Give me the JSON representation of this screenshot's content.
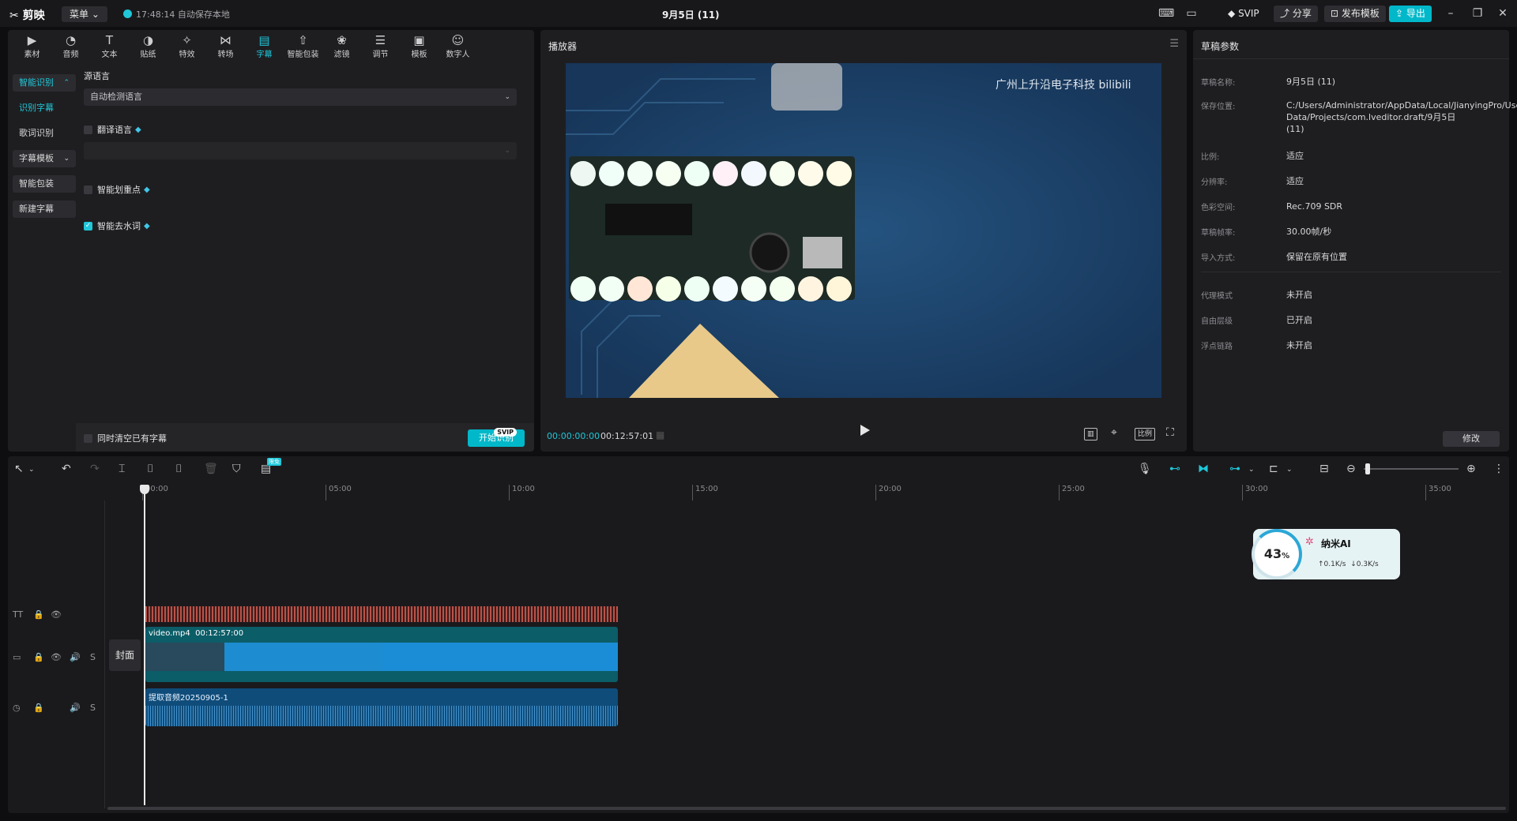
{
  "titlebar": {
    "logo": "剪映",
    "menu_label": "菜单",
    "save_status": "17:48:14 自动保存本地",
    "title": "9月5日 (11)",
    "svip_label": "SVIP",
    "share_label": "分享",
    "publish_label": "发布模板",
    "export_label": "导出"
  },
  "toolbar": {
    "items": [
      {
        "label": "素材",
        "icon": "media-icon"
      },
      {
        "label": "音频",
        "icon": "audio-icon"
      },
      {
        "label": "文本",
        "icon": "text-icon"
      },
      {
        "label": "贴纸",
        "icon": "sticker-icon"
      },
      {
        "label": "特效",
        "icon": "effects-icon"
      },
      {
        "label": "转场",
        "icon": "transition-icon"
      },
      {
        "label": "字幕",
        "icon": "caption-icon"
      },
      {
        "label": "智能包装",
        "icon": "package-icon"
      },
      {
        "label": "滤镜",
        "icon": "filter-icon"
      },
      {
        "label": "调节",
        "icon": "adjust-icon"
      },
      {
        "label": "模板",
        "icon": "template-icon"
      },
      {
        "label": "数字人",
        "icon": "avatar-icon"
      }
    ]
  },
  "sidenav": {
    "smart_recognize": "智能识别",
    "recognize_caption": "识别字幕",
    "recognize_lyrics": "歌词识别",
    "caption_template": "字幕模板",
    "smart_package": "智能包装",
    "new_caption": "新建字幕"
  },
  "caption_settings": {
    "source_language_label": "源语言",
    "source_language_value": "自动检测语言",
    "translate_label": "翻译语言",
    "smart_key_label": "智能划重点",
    "smart_filler_label": "智能去水词",
    "clear_existing_label": "同时清空已有字幕",
    "start_button": "开始识别",
    "start_badge": "SVIP"
  },
  "player": {
    "title": "播放器",
    "current_time": "00:00:00:00",
    "total_time": "00:12:57:01",
    "ratio_label": "比例",
    "watermark": "广州上升沿电子科技 bilibili"
  },
  "props": {
    "title": "草稿参数",
    "rows": [
      {
        "k": "草稿名称:",
        "v": "9月5日 (11)"
      },
      {
        "k": "保存位置:",
        "v": "C:/Users/Administrator/AppData/Local/JianyingPro/User Data/Projects/com.lveditor.draft/9月5日 (11)"
      },
      {
        "k": "比例:",
        "v": "适应"
      },
      {
        "k": "分辨率:",
        "v": "适应"
      },
      {
        "k": "色彩空间:",
        "v": "Rec.709 SDR"
      },
      {
        "k": "草稿帧率:",
        "v": "30.00帧/秒"
      },
      {
        "k": "导入方式:",
        "v": "保留在原有位置"
      },
      {
        "k": "代理模式",
        "v": "未开启"
      },
      {
        "k": "自由层级",
        "v": "已开启"
      },
      {
        "k": "浮点链路",
        "v": "未开启"
      }
    ],
    "edit_button": "修改"
  },
  "timeline": {
    "free_badge": "限免",
    "ticks": [
      "00:00",
      "05:00",
      "10:00",
      "15:00",
      "20:00",
      "25:00",
      "30:00",
      "35:00"
    ],
    "cover_label": "封面",
    "video_clip": {
      "name": "video.mp4",
      "duration": "00:12:57:00"
    },
    "audio_clip": {
      "name": "提取音频20250905-1"
    },
    "ai_widget": {
      "percent": "43",
      "unit": "%",
      "name": "纳米AI",
      "up": "0.1K/s",
      "down": "0.3K/s"
    }
  }
}
